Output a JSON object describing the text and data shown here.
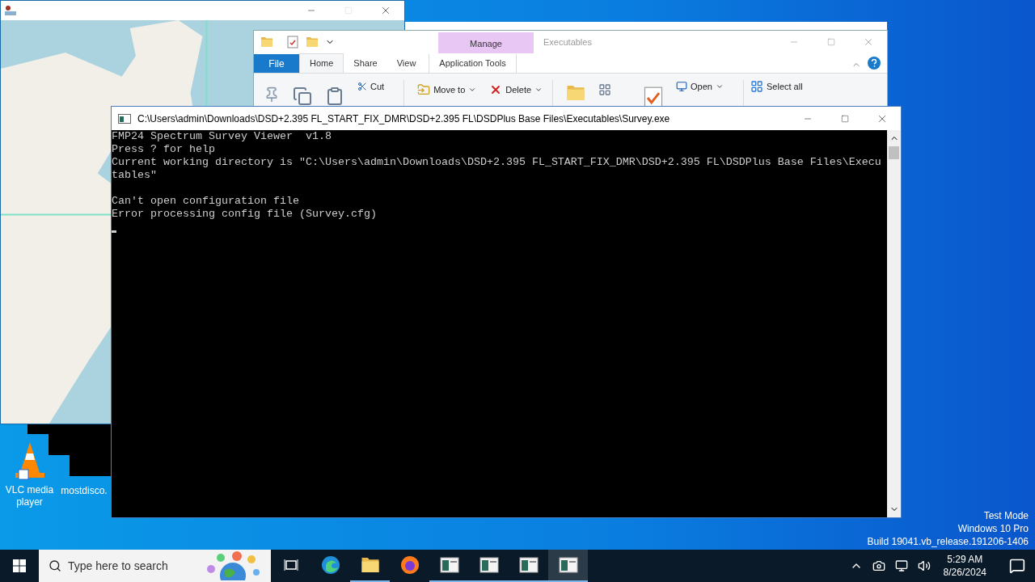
{
  "map_window": {
    "kind": "picture",
    "maximize_disabled": true
  },
  "explorer": {
    "context_tab": "Manage",
    "title": "Executables",
    "tabs": [
      {
        "label": "File",
        "kind": "file",
        "selected": false
      },
      {
        "label": "Home",
        "kind": "tab",
        "selected": true
      },
      {
        "label": "Share",
        "kind": "tab",
        "selected": false
      },
      {
        "label": "View",
        "kind": "tab",
        "selected": false
      },
      {
        "label": "Application Tools",
        "kind": "context",
        "selected": false
      }
    ],
    "ribbon": {
      "cut": "Cut",
      "move_to": "Move to",
      "delete": "Delete",
      "open": "Open",
      "select_all": "Select all"
    }
  },
  "console": {
    "title": "C:\\Users\\admin\\Downloads\\DSD+2.395 FL_START_FIX_DMR\\DSD+2.395 FL\\DSDPlus Base Files\\Executables\\Survey.exe",
    "blocks": [
      [
        "FMP24 Spectrum Survey Viewer  v1.8",
        "Press ? for help",
        "Current working directory is \"C:\\Users\\admin\\Downloads\\DSD+2.395 FL_START_FIX_DMR\\DSD+2.395 FL\\DSDPlus Base Files\\Executables\""
      ],
      [
        "Can't open configuration file",
        "Error processing config file (Survey.cfg)"
      ]
    ],
    "cursor": true
  },
  "desktop_icons": [
    {
      "label": "VLC media player",
      "kind": "vlc"
    },
    {
      "label": "mostdisco.",
      "kind": "blank"
    }
  ],
  "system_notice": [
    "Test Mode",
    "Windows 10 Pro",
    "Build 19041.vb_release.191206-1406"
  ],
  "taskbar": {
    "search_placeholder": "Type here to search",
    "apps": [
      {
        "kind": "taskview",
        "running": false,
        "selected": false
      },
      {
        "kind": "edge",
        "running": false,
        "selected": false
      },
      {
        "kind": "folder",
        "running": true,
        "selected": false
      },
      {
        "kind": "firefox",
        "running": false,
        "selected": false
      },
      {
        "kind": "window",
        "running": true,
        "selected": false
      },
      {
        "kind": "window",
        "running": true,
        "selected": false
      },
      {
        "kind": "window",
        "running": true,
        "selected": false
      },
      {
        "kind": "window",
        "running": true,
        "selected": true
      }
    ],
    "time": "5:29 AM",
    "date": "8/26/2024"
  }
}
